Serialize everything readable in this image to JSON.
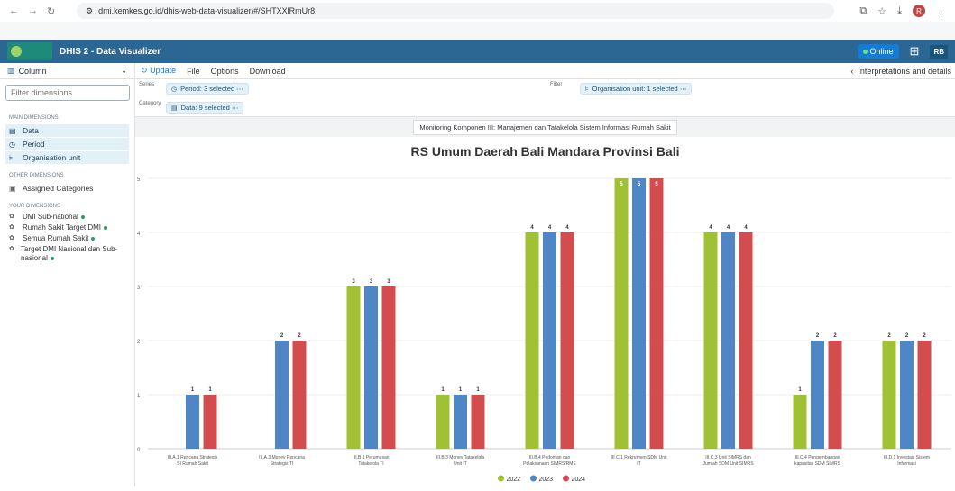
{
  "browser": {
    "url": "dmi.kemkes.go.id/dhis-web-data-visualizer/#/SHTXXlRmUr8"
  },
  "header": {
    "app_title": "DHIS 2 - Data Visualizer",
    "online_label": "Online",
    "user_initials": "RB"
  },
  "sidebar": {
    "vis_type": "Column",
    "filter_placeholder": "Filter dimensions",
    "main_dimensions_heading": "MAIN DIMENSIONS",
    "main_items": [
      {
        "label": "Data",
        "icon": "data-icon"
      },
      {
        "label": "Period",
        "icon": "clock-icon"
      },
      {
        "label": "Organisation unit",
        "icon": "org-unit-icon"
      }
    ],
    "other_dimensions_heading": "OTHER DIMENSIONS",
    "other_items": [
      {
        "label": "Assigned Categories",
        "icon": "categories-icon"
      }
    ],
    "your_dimensions_heading": "YOUR DIMENSIONS",
    "your_items": [
      {
        "label": "DMI Sub-national"
      },
      {
        "label": "Rumah Sakit Target DMI"
      },
      {
        "label": "Semua Rumah Sakit"
      },
      {
        "label": "Target DMI Nasional dan Sub-nasional"
      }
    ]
  },
  "toolbar": {
    "update_label": "Update",
    "file_label": "File",
    "options_label": "Options",
    "download_label": "Download",
    "interpretations_label": "Interpretations and details"
  },
  "layout": {
    "series_label": "Series",
    "category_label": "Category",
    "filter_label": "Filter",
    "series_chip": "Period: 3 selected",
    "category_chip": "Data: 9 selected",
    "filter_chip": "Organisation unit: 1 selected"
  },
  "visualization": {
    "subtitle": "Monitoring Komponen III: Manajemen dan Tatakelola Sistem Informasi Rumah Sakit"
  },
  "chart_data": {
    "type": "bar",
    "title": "RS Umum Daerah Bali Mandara Provinsi Bali",
    "categories": [
      "III.A.1 Rencana Strategis SI Rumah Sakit",
      "III.A.3 Monev Rencana Strategis TI",
      "III.B.1 Perumusan Tatakelola TI",
      "III.B.3 Monev Tatakelola Unit IT",
      "III.B.4 Pedoman dan Pelaksanaan SIMRS/RME",
      "III.C.1 Rekrutmen SDM Unit IT",
      "III.C.3 Unit SIMRS dan Jumlah SDM Unit SIMRS",
      "III.C.4 Pengembangan kapasitas SDM SIMRS",
      "III.D.1 Investasi Sistem Informasi"
    ],
    "series": [
      {
        "name": "2022",
        "color": "#a0c133",
        "values": [
          null,
          null,
          3,
          1,
          4,
          5,
          4,
          1,
          2
        ]
      },
      {
        "name": "2023",
        "color": "#4f87c6",
        "values": [
          1,
          2,
          3,
          1,
          4,
          5,
          4,
          2,
          2
        ]
      },
      {
        "name": "2024",
        "color": "#d34d4f",
        "values": [
          1,
          2,
          3,
          1,
          4,
          5,
          4,
          2,
          2
        ]
      }
    ],
    "ylim": [
      0,
      5
    ],
    "yticks": [
      0,
      1,
      2,
      3,
      4,
      5
    ],
    "grid": true,
    "legend": "bottom-center"
  }
}
